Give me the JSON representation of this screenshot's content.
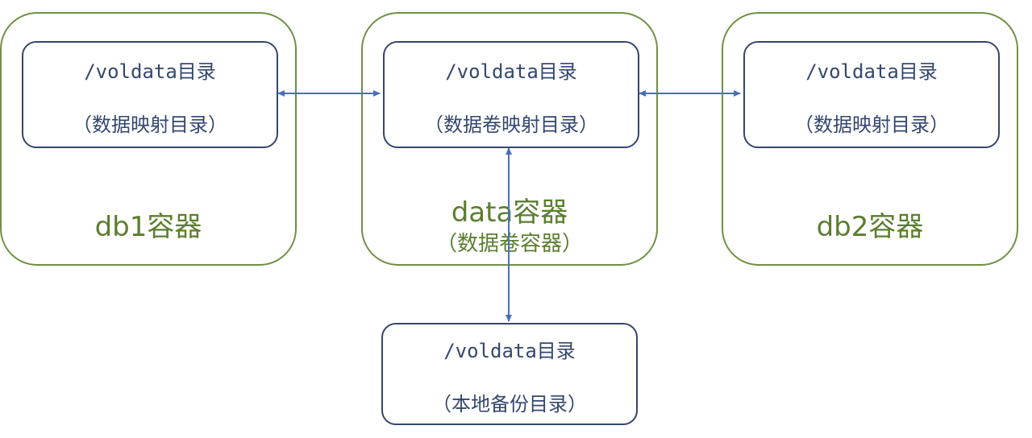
{
  "colors": {
    "container_border": "#6e9141",
    "container_label": "#5b7e2f",
    "inner_border": "#33466e",
    "inner_text": "#34476f",
    "arrow": "#4a6fb5"
  },
  "db1": {
    "container_label": "db1容器",
    "dir_path": "/voldata目录",
    "dir_desc": "（数据映射目录）"
  },
  "data": {
    "container_label": "data容器",
    "container_sublabel": "（数据卷容器）",
    "dir_path": "/voldata目录",
    "dir_desc": "（数据卷映射目录）"
  },
  "db2": {
    "container_label": "db2容器",
    "dir_path": "/voldata目录",
    "dir_desc": "（数据映射目录）"
  },
  "local": {
    "dir_path": "/voldata目录",
    "dir_desc": "（本地备份目录）"
  }
}
